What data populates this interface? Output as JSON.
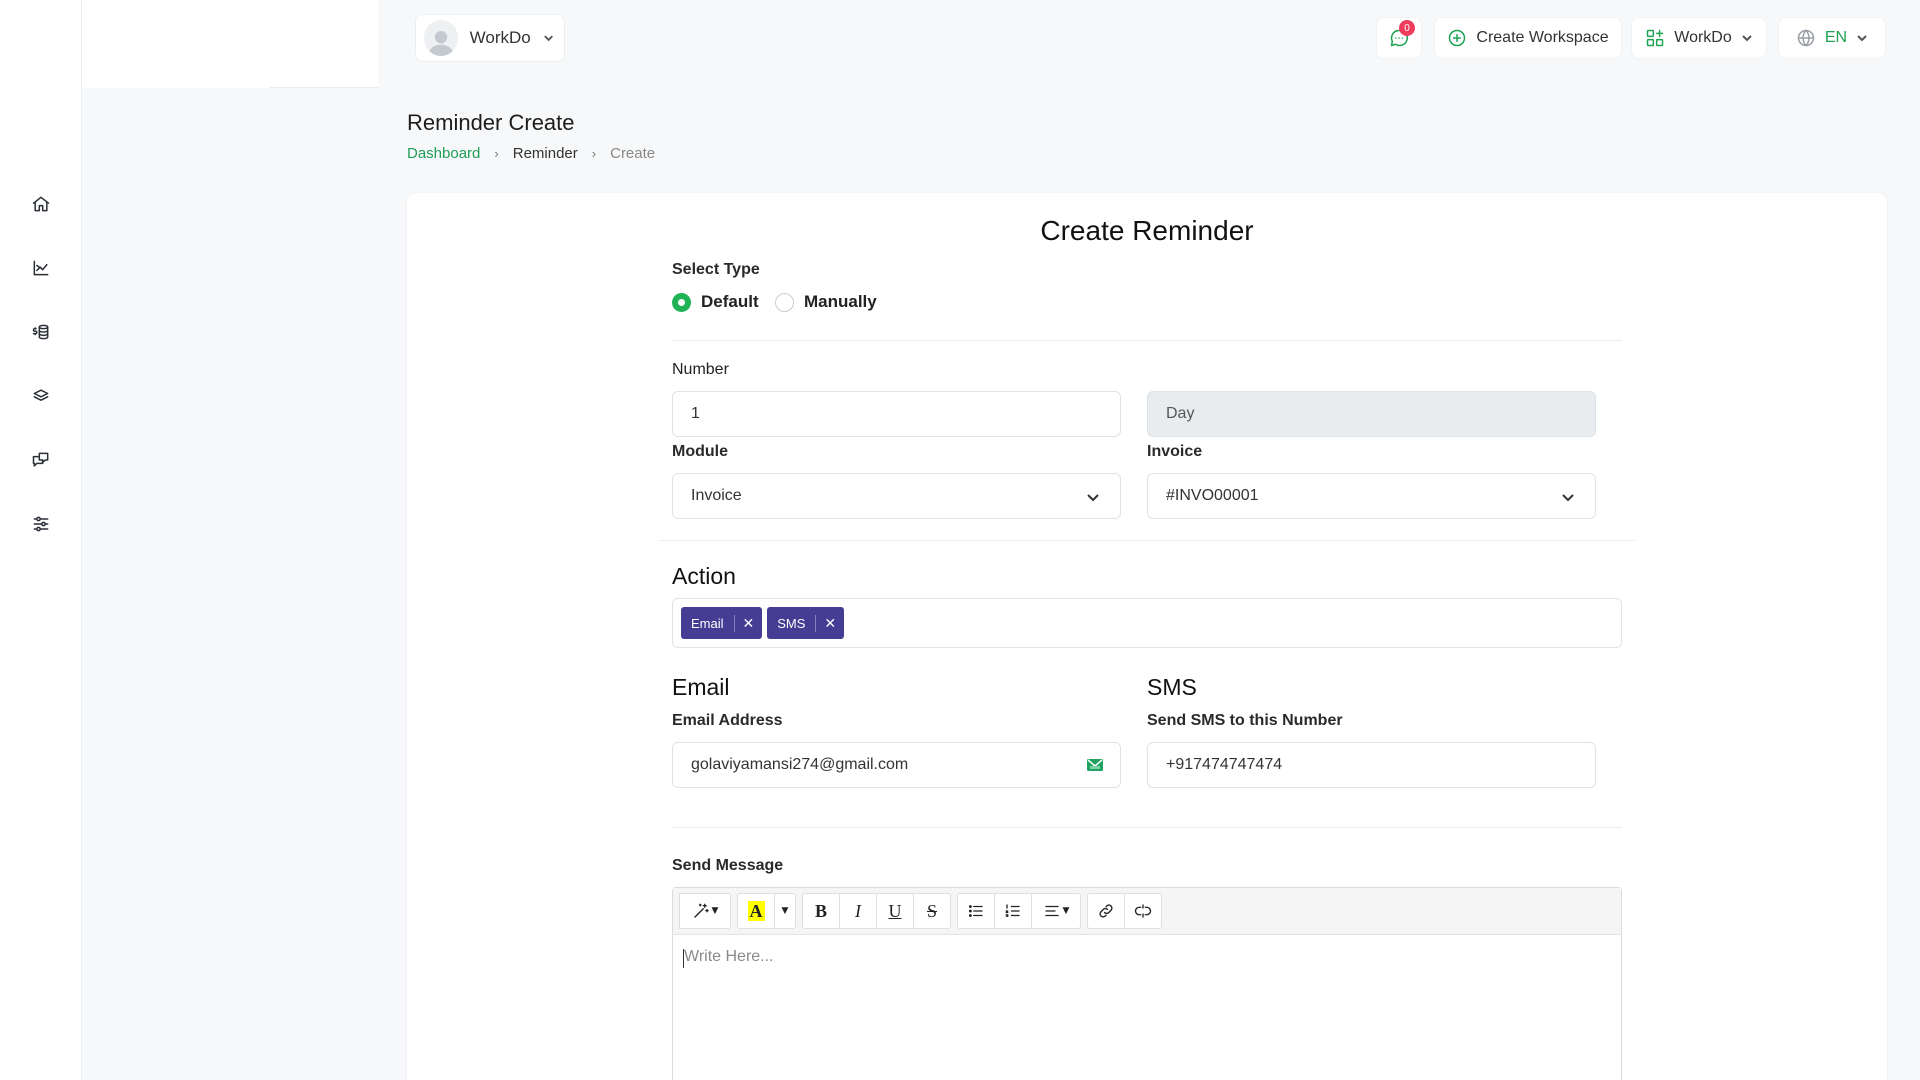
{
  "header": {
    "user_name": "WorkDo",
    "notification_count": "0",
    "create_workspace_label": "Create Workspace",
    "workspace_name": "WorkDo",
    "language": "EN"
  },
  "sidebar": {
    "items": [
      {
        "icon": "home-icon"
      },
      {
        "icon": "chart-icon"
      },
      {
        "icon": "finance-icon"
      },
      {
        "icon": "layers-icon"
      },
      {
        "icon": "messages-icon"
      },
      {
        "icon": "settings-sliders-icon"
      }
    ]
  },
  "page": {
    "title": "Reminder Create",
    "breadcrumb": [
      "Dashboard",
      "Reminder",
      "Create"
    ]
  },
  "form": {
    "title": "Create Reminder",
    "select_type_label": "Select Type",
    "type_options": [
      "Default",
      "Manually"
    ],
    "type_selected": "Default",
    "number_label": "Number",
    "number_value": "1",
    "unit_value": "Day",
    "module_label": "Module",
    "module_value": "Invoice",
    "invoice_label": "Invoice",
    "invoice_value": "#INVO00001",
    "action_heading": "Action",
    "action_tags": [
      "Email",
      "SMS"
    ],
    "email_heading": "Email",
    "email_address_label": "Email Address",
    "email_address_value": "golaviyamansi274@gmail.com",
    "sms_heading": "SMS",
    "sms_label": "Send SMS to this Number",
    "sms_value": "+917474747474",
    "message_label": "Send Message",
    "message_placeholder": "Write Here..."
  },
  "colors": {
    "accent_green": "#1fb355",
    "tag_purple": "#453d93",
    "badge_red": "#ef3e5c"
  }
}
